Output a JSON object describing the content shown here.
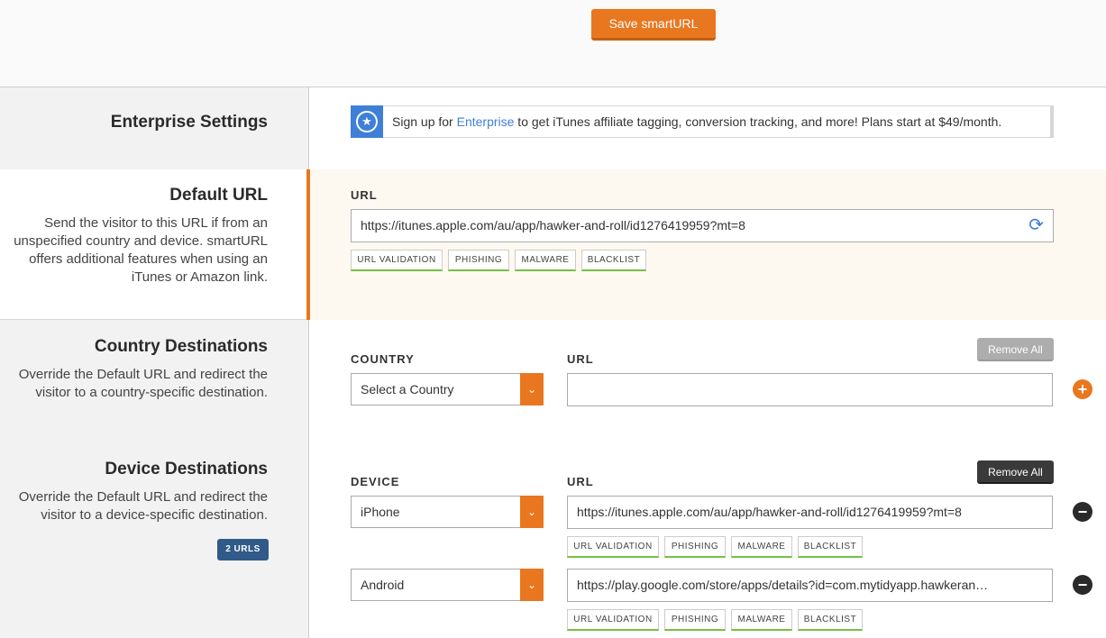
{
  "toolbar": {
    "save_label": "Save smartURL"
  },
  "enterprise": {
    "title": "Enterprise Settings",
    "text_before": "Sign up for ",
    "link": "Enterprise",
    "text_after": " to get iTunes affiliate tagging, conversion tracking, and more! Plans start at $49/month."
  },
  "default_url": {
    "title": "Default URL",
    "description": "Send the visitor to this URL if from an unspecified country and device. smartURL offers additional features when using an iTunes or Amazon link.",
    "field_label": "URL",
    "value": "https://itunes.apple.com/au/app/hawker-and-roll/id1276419959?mt=8",
    "tags": [
      "URL VALIDATION",
      "PHISHING",
      "MALWARE",
      "BLACKLIST"
    ]
  },
  "country": {
    "title": "Country Destinations",
    "description": "Override the Default URL and redirect the visitor to a country-specific destination.",
    "country_label": "COUNTRY",
    "url_label": "URL",
    "remove_all": "Remove All",
    "select_value": "Select a Country",
    "url_value": ""
  },
  "device": {
    "title": "Device Destinations",
    "description": "Override the Default URL and redirect the visitor to a device-specific destination.",
    "badge": "2 URLS",
    "device_label": "DEVICE",
    "url_label": "URL",
    "remove_all": "Remove All",
    "rows": [
      {
        "device": "iPhone",
        "url": "https://itunes.apple.com/au/app/hawker-and-roll/id1276419959?mt=8",
        "tags": [
          "URL VALIDATION",
          "PHISHING",
          "MALWARE",
          "BLACKLIST"
        ]
      },
      {
        "device": "Android",
        "url": "https://play.google.com/store/apps/details?id=com.mytidyapp.hawkeran…",
        "tags": [
          "URL VALIDATION",
          "PHISHING",
          "MALWARE",
          "BLACKLIST"
        ]
      }
    ]
  },
  "colors": {
    "accent": "#e8771f",
    "link": "#3f7fd8",
    "tag_underline": "#77c043",
    "badge": "#2f5a8a"
  },
  "icons": {
    "star": "star-icon",
    "refresh": "refresh-icon",
    "add": "plus-icon",
    "remove": "minus-icon",
    "dropdown": "chevron-down-icon"
  }
}
